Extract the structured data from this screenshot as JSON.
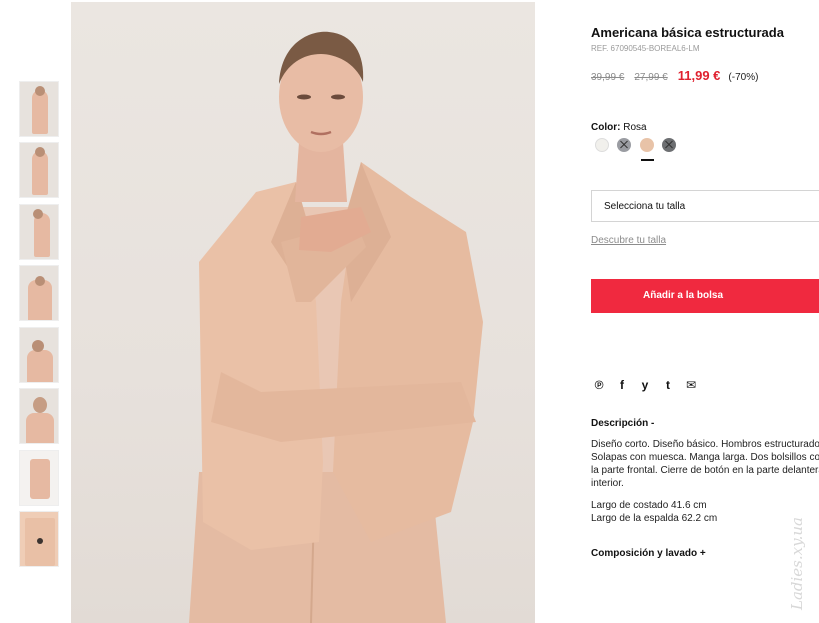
{
  "product": {
    "title": "Americana básica estructurada",
    "reference": "REF. 67090545-BOREAL6-LM",
    "old_price_1": "39,99 €",
    "old_price_2": "27,99 €",
    "current_price": "11,99 €",
    "discount": "(-70%)"
  },
  "color": {
    "label": "Color:",
    "value": "Rosa",
    "swatches": [
      {
        "name": "off-white",
        "hex": "#f1f0ec",
        "available": true
      },
      {
        "name": "grey",
        "hex": "#9a9ca2",
        "available": false
      },
      {
        "name": "rosa",
        "hex": "#e8c3a8",
        "available": true,
        "selected": true
      },
      {
        "name": "dark-grey",
        "hex": "#6d6f72",
        "available": false
      }
    ]
  },
  "size": {
    "select_label": "Selecciona tu talla",
    "discover_link": "Descubre tu talla"
  },
  "cart": {
    "add_button": "Añadir a la bolsa"
  },
  "social": {
    "icons": [
      "pinterest-icon",
      "facebook-icon",
      "twitter-icon",
      "tumblr-icon",
      "email-icon"
    ],
    "glyphs": [
      "℗",
      "f",
      "y",
      "t",
      "✉"
    ]
  },
  "description": {
    "heading": "Descripción -",
    "lines": [
      "Diseño corto. Diseño básico. Hombros estructurados.",
      "Solapas con muesca. Manga larga. Dos bolsillos con solapa en",
      "la parte frontal. Cierre de botón en la parte delantera. Forro",
      "interior."
    ],
    "measurements": [
      "Largo de costado 41.6 cm",
      "Largo de la espalda 62.2 cm"
    ]
  },
  "composition": {
    "heading": "Composición y lavado +"
  },
  "watermark": "Ladies.xy.ua",
  "colors": {
    "accent": "#f0293f",
    "sale_price": "#e0212f"
  }
}
